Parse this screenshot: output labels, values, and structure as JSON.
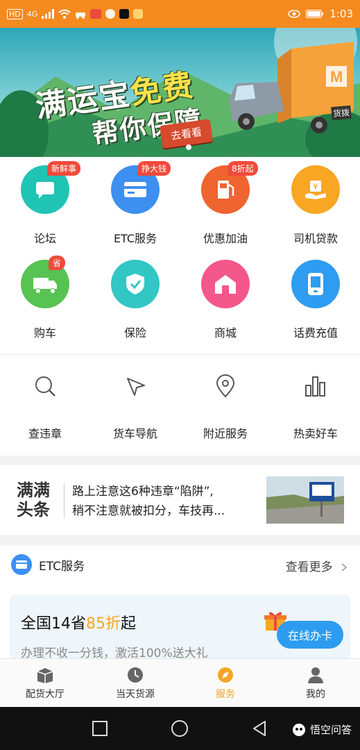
{
  "status_bar": {
    "left_labels": [
      "HD",
      "4G"
    ],
    "time": "1:03"
  },
  "banner": {
    "title_part1": "满运宝",
    "title_part2": "免费",
    "title_line2": "帮你保障",
    "button_label": "去看看",
    "truck_label": "货拨"
  },
  "grid": {
    "items": [
      {
        "label": "论坛",
        "badge": "新鲜事",
        "color": "#20c4b4",
        "icon": "forum-icon"
      },
      {
        "label": "ETC服务",
        "badge": "挣大钱",
        "color": "#3d8ff0",
        "icon": "card-icon"
      },
      {
        "label": "优惠加油",
        "badge": "8折起",
        "color": "#f0642f",
        "icon": "fuel-icon"
      },
      {
        "label": "司机贷款",
        "badge": "",
        "color": "#f8a623",
        "icon": "loan-icon"
      },
      {
        "label": "购车",
        "badge": "省",
        "color": "#56c352",
        "icon": "truck-icon"
      },
      {
        "label": "保险",
        "badge": "",
        "color": "#32c6c4",
        "icon": "shield-icon"
      },
      {
        "label": "商城",
        "badge": "",
        "color": "#f4578a",
        "icon": "store-icon"
      },
      {
        "label": "话费充值",
        "badge": "",
        "color": "#2e9cf0",
        "icon": "phone-icon"
      }
    ]
  },
  "tools": {
    "items": [
      {
        "label": "查违章",
        "icon": "search-icon"
      },
      {
        "label": "货车导航",
        "icon": "navigation-icon"
      },
      {
        "label": "附近服务",
        "icon": "location-pin-icon"
      },
      {
        "label": "热卖好车",
        "icon": "bar-chart-icon"
      }
    ]
  },
  "news": {
    "brand_line1": "满满",
    "brand_line2": "头条",
    "headline_line1": "路上注意这6种违章“陷阱”,",
    "headline_line2": "稍不注意就被扣分，车技再..."
  },
  "etc": {
    "title": "ETC服务",
    "more_label": "查看更多",
    "card_title_prefix": "全国14省",
    "card_title_highlight": "85折",
    "card_title_suffix": "起",
    "card_subtitle": "办理不收一分钱，激活100%送大礼",
    "card_button": "在线办卡"
  },
  "tabbar": {
    "items": [
      {
        "label": "配货大厅",
        "icon": "box-icon",
        "active": false
      },
      {
        "label": "当天货源",
        "icon": "clock-icon",
        "active": false
      },
      {
        "label": "服务",
        "icon": "compass-icon",
        "active": true
      },
      {
        "label": "我的",
        "icon": "user-icon",
        "active": false
      }
    ]
  },
  "watermark": {
    "text": "悟空问答"
  },
  "colors": {
    "status_bar": "#f58a1f",
    "accent": "#f5a623",
    "button_blue": "#2d9cf0"
  }
}
